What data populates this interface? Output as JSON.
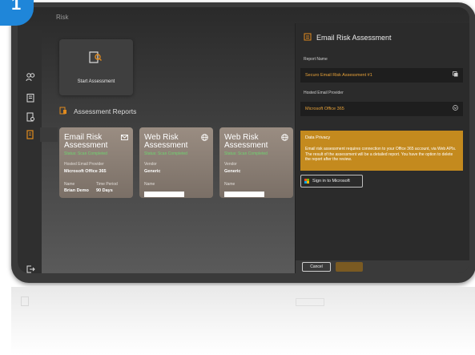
{
  "app": {
    "badge_number": "1",
    "top_label": "Risk"
  },
  "sidebar": {
    "items": [
      {
        "icon": "people-icon"
      },
      {
        "icon": "building-icon"
      },
      {
        "icon": "report-icon"
      },
      {
        "icon": "assessment-icon",
        "active": true
      }
    ],
    "logout_icon": "logout-icon"
  },
  "main": {
    "start_tile_label": "Start Assessment",
    "reports_title": "Assessment Reports",
    "cards": [
      {
        "title_line1": "Email Risk",
        "title_line2": "Assessment",
        "status": "Status: Scan Completed",
        "provider_label": "Hosted Email Provider",
        "provider_value": "Microsoft Office 365",
        "name_label": "Name",
        "name_value": "Brian Demo",
        "period_label": "Time Period",
        "period_value": "90 Days"
      },
      {
        "title_line1": "Web Risk",
        "title_line2": "Assessment",
        "status": "Status: Scan Completed",
        "vendor_label": "Vendor",
        "vendor_value": "Generic",
        "name_label": "Name"
      },
      {
        "title_line1": "Web Risk",
        "title_line2": "Assessment",
        "status": "Status: Scan Completed",
        "vendor_label": "Vendor",
        "vendor_value": "Generic",
        "name_label": "Name"
      }
    ]
  },
  "panel": {
    "title": "Email Risk Assessment",
    "report_name_label": "Report Name",
    "report_name_value": "Securo Email Risk Assessment #1",
    "provider_label": "Hosted Email Provider",
    "provider_value": "Microsoft Office 365",
    "privacy_title": "Data Privacy",
    "privacy_text": "Email risk assessment requires connection to your Office 365 account, via Web APIs. The result of the assessment will be a detailed report. You have the option to delete the report after the review.",
    "signin_label": "Sign in to Microsoft",
    "cancel_label": "Cancel"
  },
  "colors": {
    "accent": "#e08a1e",
    "status_green": "#6fd36f",
    "privacy_bg": "#c48a1e",
    "badge_blue": "#1f86d9"
  }
}
